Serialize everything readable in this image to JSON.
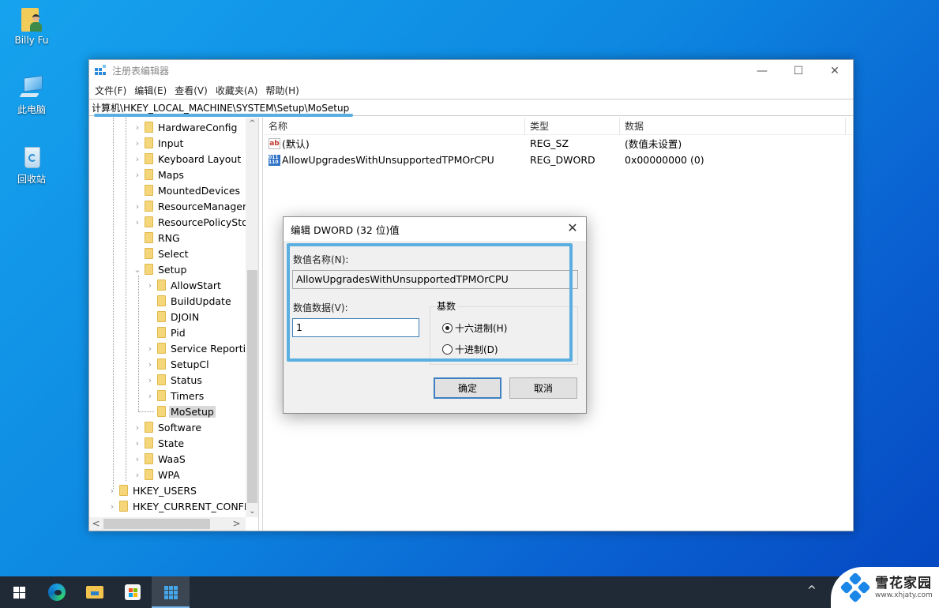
{
  "desktop": {
    "icons": [
      {
        "label": "Billy Fu",
        "icon": "user-folder-icon"
      },
      {
        "label": "此电脑",
        "icon": "this-pc-icon"
      },
      {
        "label": "回收站",
        "icon": "recycle-bin-icon"
      }
    ]
  },
  "window": {
    "title": "注册表编辑器",
    "controls": {
      "minimize": "—",
      "maximize": "☐",
      "close": "✕"
    },
    "menu": [
      "文件(F)",
      "编辑(E)",
      "查看(V)",
      "收藏夹(A)",
      "帮助(H)"
    ],
    "address": "计算机\\HKEY_LOCAL_MACHINE\\SYSTEM\\Setup\\MoSetup"
  },
  "tree": {
    "items": [
      {
        "label": "HardwareConfig",
        "expander": "›"
      },
      {
        "label": "Input",
        "expander": "›"
      },
      {
        "label": "Keyboard Layout",
        "expander": "›"
      },
      {
        "label": "Maps",
        "expander": "›"
      },
      {
        "label": "MountedDevices",
        "expander": ""
      },
      {
        "label": "ResourceManager",
        "expander": "›"
      },
      {
        "label": "ResourcePolicySto",
        "expander": "›"
      },
      {
        "label": "RNG",
        "expander": ""
      },
      {
        "label": "Select",
        "expander": ""
      },
      {
        "label": "Setup",
        "expander": "⌄"
      },
      {
        "label": "AllowStart",
        "expander": "›"
      },
      {
        "label": "BuildUpdate",
        "expander": ""
      },
      {
        "label": "DJOIN",
        "expander": ""
      },
      {
        "label": "Pid",
        "expander": ""
      },
      {
        "label": "Service Reportir",
        "expander": "›"
      },
      {
        "label": "SetupCl",
        "expander": "›"
      },
      {
        "label": "Status",
        "expander": "›"
      },
      {
        "label": "Timers",
        "expander": "›"
      },
      {
        "label": "MoSetup",
        "expander": ""
      },
      {
        "label": "Software",
        "expander": "›"
      },
      {
        "label": "State",
        "expander": "›"
      },
      {
        "label": "WaaS",
        "expander": "›"
      },
      {
        "label": "WPA",
        "expander": "›"
      },
      {
        "label": "HKEY_USERS",
        "expander": "›"
      },
      {
        "label": "HKEY_CURRENT_CONFI(",
        "expander": "›"
      }
    ],
    "selected": "MoSetup",
    "scroll": {
      "up": "^",
      "down": "⌄",
      "left": "<",
      "right": ">"
    }
  },
  "list": {
    "headers": {
      "name": "名称",
      "type": "类型",
      "data": "数据"
    },
    "rows": [
      {
        "icon": "ab",
        "name": "(默认)",
        "type": "REG_SZ",
        "data": "(数值未设置)"
      },
      {
        "icon": "011 110",
        "name": "AllowUpgradesWithUnsupportedTPMOrCPU",
        "type": "REG_DWORD",
        "data": "0x00000000 (0)"
      }
    ]
  },
  "dialog": {
    "title": "编辑 DWORD (32 位)值",
    "close": "✕",
    "value_name_label": "数值名称(N):",
    "value_name": "AllowUpgradesWithUnsupportedTPMOrCPU",
    "value_data_label": "数值数据(V):",
    "value_data": "1",
    "base_label": "基数",
    "base_options": [
      {
        "label": "十六进制(H)",
        "checked": true
      },
      {
        "label": "十进制(D)",
        "checked": false
      }
    ],
    "ok": "确定",
    "cancel": "取消"
  },
  "taskbar": {
    "items": [
      "start-button",
      "edge",
      "file-explorer",
      "microsoft-store",
      "registry-editor"
    ],
    "active": "registry-editor",
    "tray_chevron": "^"
  },
  "watermark": {
    "name": "雪花家园",
    "url": "www.xhjaty.com"
  }
}
